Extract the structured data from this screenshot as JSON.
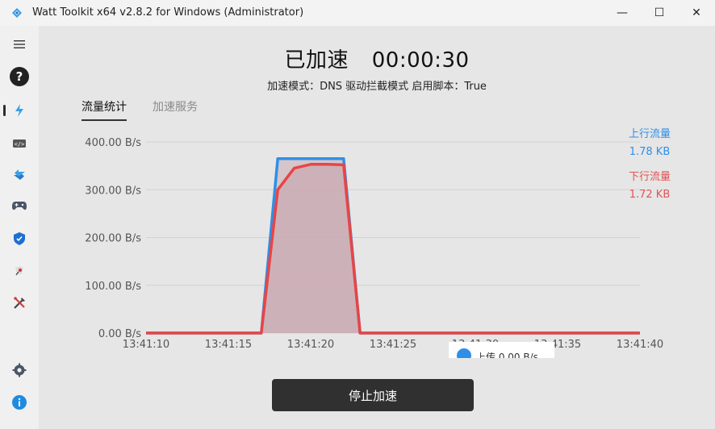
{
  "window": {
    "title": "Watt Toolkit x64 v2.8.2 for Windows (Administrator)",
    "minimize_glyph": "—",
    "maximize_glyph": "☐",
    "close_glyph": "✕"
  },
  "sidebar": {
    "menu_icon": "hamburger-menu-icon",
    "items": [
      {
        "icon": "help-circle-icon"
      },
      {
        "icon": "lightning-accelerate-icon",
        "active": true
      },
      {
        "icon": "code-script-icon"
      },
      {
        "icon": "transfer-arrows-icon"
      },
      {
        "icon": "gamepad-icon"
      },
      {
        "icon": "shield-icon"
      },
      {
        "icon": "arknights-icon"
      },
      {
        "icon": "tools-icon"
      }
    ],
    "bottom_items": [
      {
        "icon": "settings-gear-icon"
      },
      {
        "icon": "info-icon"
      }
    ]
  },
  "status": {
    "label": "已加速",
    "timer": "00:00:30",
    "mode_line": "加速模式：DNS 驱动拦截模式  启用脚本：True"
  },
  "tabs": [
    {
      "label": "流量统计",
      "active": true
    },
    {
      "label": "加速服务",
      "active": false
    }
  ],
  "legend": {
    "upload_label": "上行流量",
    "upload_value": "1.78 KB",
    "download_label": "下行流量",
    "download_value": "1.72 KB"
  },
  "toast": {
    "text": "上传 0.00 B/s"
  },
  "stop_button": "停止加速",
  "colors": {
    "upload": "#2f8fe8",
    "download": "#e84545",
    "fill": "#c9aab2",
    "button_bg": "#303030"
  },
  "chart_data": {
    "type": "area",
    "ylim": [
      0,
      400
    ],
    "y_ticks": [
      "0.00 B/s",
      "100.00 B/s",
      "200.00 B/s",
      "300.00 B/s",
      "400.00 B/s"
    ],
    "x_ticks": [
      "13:41:10",
      "13:41:15",
      "13:41:20",
      "13:41:25",
      "13:41:30",
      "13:41:35",
      "13:41:40"
    ],
    "series": [
      {
        "name": "上行流量",
        "x": [
          "13:41:10",
          "13:41:11",
          "13:41:12",
          "13:41:13",
          "13:41:14",
          "13:41:15",
          "13:41:16",
          "13:41:17",
          "13:41:18",
          "13:41:19",
          "13:41:20",
          "13:41:21",
          "13:41:22",
          "13:41:23",
          "13:41:24",
          "13:41:25",
          "13:41:26",
          "13:41:27",
          "13:41:28",
          "13:41:29",
          "13:41:30",
          "13:41:31",
          "13:41:32",
          "13:41:33",
          "13:41:34",
          "13:41:35",
          "13:41:36",
          "13:41:37",
          "13:41:38",
          "13:41:39",
          "13:41:40"
        ],
        "values": [
          0,
          0,
          0,
          0,
          0,
          0,
          0,
          0,
          365,
          365,
          365,
          365,
          365,
          0,
          0,
          0,
          0,
          0,
          0,
          0,
          0,
          0,
          0,
          0,
          0,
          0,
          0,
          0,
          0,
          0,
          0
        ]
      },
      {
        "name": "下行流量",
        "x": [
          "13:41:10",
          "13:41:11",
          "13:41:12",
          "13:41:13",
          "13:41:14",
          "13:41:15",
          "13:41:16",
          "13:41:17",
          "13:41:18",
          "13:41:19",
          "13:41:20",
          "13:41:21",
          "13:41:22",
          "13:41:23",
          "13:41:24",
          "13:41:25",
          "13:41:26",
          "13:41:27",
          "13:41:28",
          "13:41:29",
          "13:41:30",
          "13:41:31",
          "13:41:32",
          "13:41:33",
          "13:41:34",
          "13:41:35",
          "13:41:36",
          "13:41:37",
          "13:41:38",
          "13:41:39",
          "13:41:40"
        ],
        "values": [
          0,
          0,
          0,
          0,
          0,
          0,
          0,
          0,
          300,
          345,
          353,
          353,
          352,
          0,
          0,
          0,
          0,
          0,
          0,
          0,
          0,
          0,
          0,
          0,
          0,
          0,
          0,
          0,
          0,
          0,
          0
        ]
      }
    ]
  }
}
